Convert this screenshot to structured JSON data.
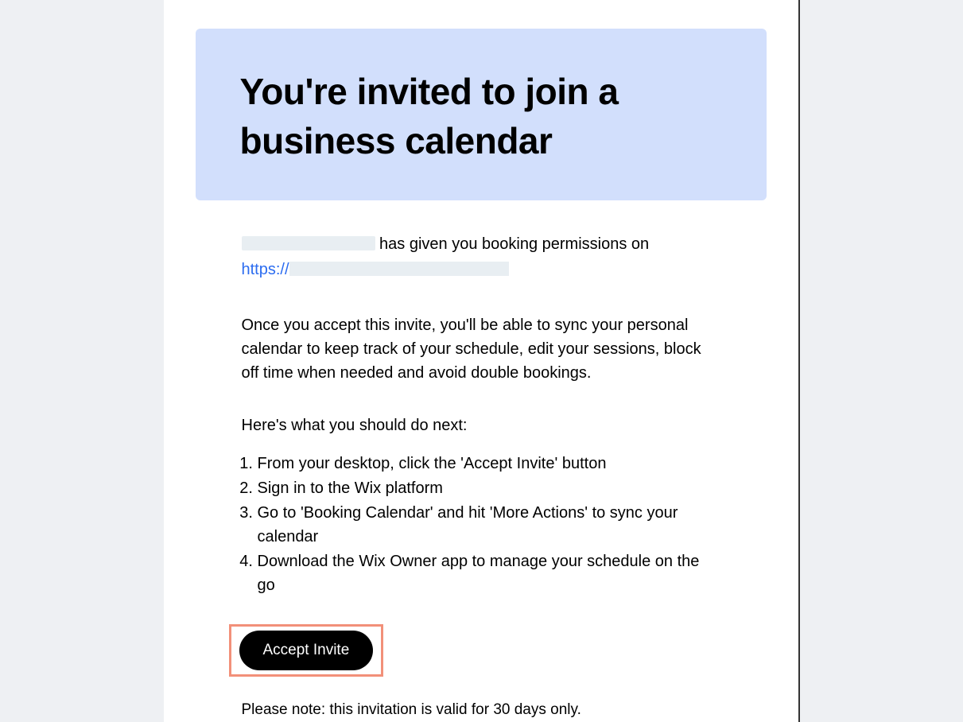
{
  "hero": {
    "title": "You're invited to join a business calendar"
  },
  "intro": {
    "suffix_text": " has given you booking permissions on",
    "link_prefix": "https://"
  },
  "description": "Once you accept this invite, you'll be able to sync your personal calendar to keep track of your schedule, edit your sessions, block off time when needed and avoid double bookings.",
  "next_label": "Here's what you should do next:",
  "steps": [
    "From your desktop, click the 'Accept Invite' button",
    "Sign in to the Wix platform",
    "Go to 'Booking Calendar' and hit 'More Actions' to sync your calendar",
    "Download the Wix Owner app to manage your schedule on the go"
  ],
  "cta": {
    "label": "Accept Invite"
  },
  "note": "Please note: this invitation is valid for 30 days only."
}
